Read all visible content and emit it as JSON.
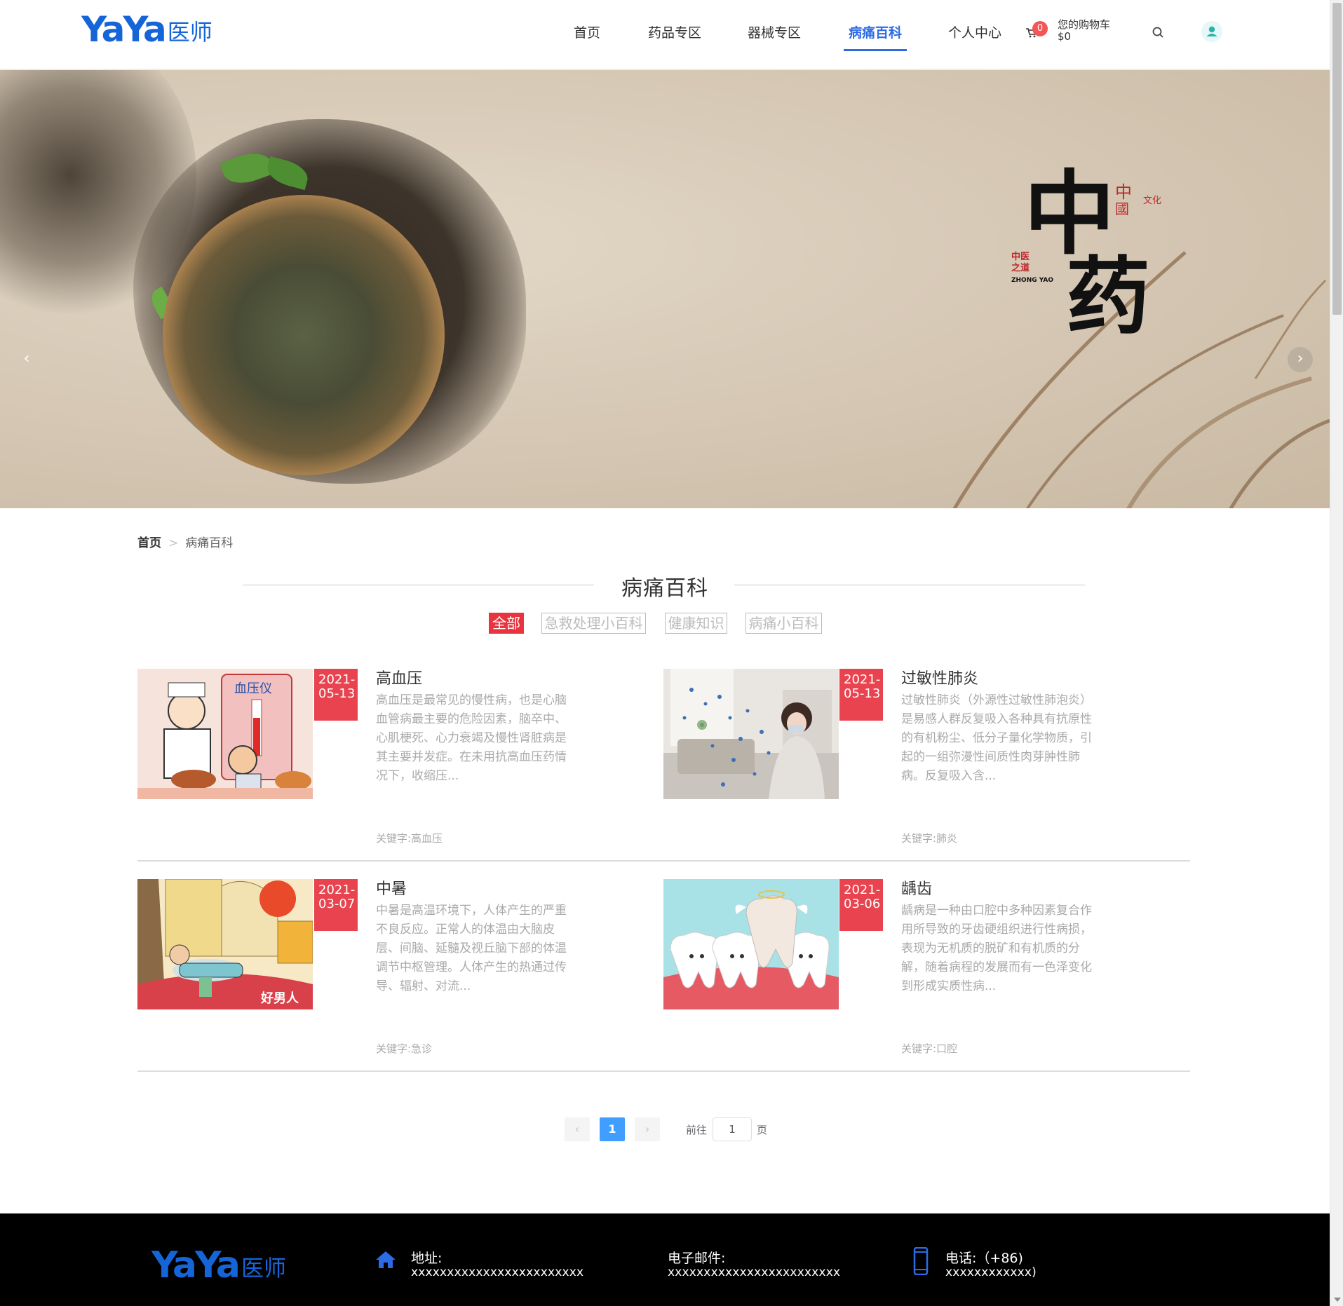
{
  "brand": {
    "logo_latin": "YaYa",
    "logo_cn": "医师",
    "accent": "#2d6be6",
    "logo_color": "#1565d8"
  },
  "nav": {
    "items": [
      {
        "label": "首页"
      },
      {
        "label": "药品专区"
      },
      {
        "label": "器械专区"
      },
      {
        "label": "病痛百科",
        "active": true
      },
      {
        "label": "个人中心"
      }
    ],
    "cart": {
      "count": "0",
      "label": "您的购物车",
      "amount": "$0"
    },
    "search_icon": "search-icon",
    "user_icon": "user-icon"
  },
  "banner": {
    "calligraphy_text": "中药",
    "calligraphy_subtitle": "中医之道",
    "calligraphy_romanization": "ZHONG YAO",
    "seal_text": "中國文化",
    "slides_total": 4,
    "active_slide": 3,
    "prev_label": "‹",
    "next_label": "›"
  },
  "breadcrumb": {
    "home": "首页",
    "separator": ">",
    "current": "病痛百科"
  },
  "section": {
    "title": "病痛百科"
  },
  "filters": [
    {
      "label": "全部",
      "active": true
    },
    {
      "label": "急救处理小百科"
    },
    {
      "label": "健康知识"
    },
    {
      "label": "病痛小百科"
    }
  ],
  "articles": [
    {
      "date_line1": "2021-",
      "date_line2": "05-13",
      "title": "高血压",
      "desc": "高血压是最常见的慢性病，也是心脑血管病最主要的危险因素，脑卒中、心肌梗死、心力衰竭及慢性肾脏病是其主要并发症。在未用抗高血压药情况下，收缩压...",
      "keyword": "关键字:高血压",
      "image_text": "血压仪"
    },
    {
      "date_line1": "2021-",
      "date_line2": "05-13",
      "title": "过敏性肺炎",
      "desc": "过敏性肺炎（外源性过敏性肺泡炎）是易感人群反复吸入各种具有抗原性的有机粉尘、低分子量化学物质，引起的一组弥漫性间质性肉芽肿性肺病。反复吸入含...",
      "keyword": "关键字:肺炎"
    },
    {
      "date_line1": "2021-",
      "date_line2": "03-07",
      "title": "中暑",
      "desc": "中暑是高温环境下，人体产生的严重不良反应。正常人的体温由大脑皮层、间脑、延髓及视丘脑下部的体温调节中枢管理。人体产生的热通过传导、辐射、对流...",
      "keyword": "关键字:急诊",
      "image_text": "好男人"
    },
    {
      "date_line1": "2021-",
      "date_line2": "03-06",
      "title": "龋齿",
      "desc": "龋病是一种由口腔中多种因素复合作用所导致的牙齿硬组织进行性病损，表现为无机质的脱矿和有机质的分解，随着病程的发展而有一色泽变化到形成实质性病...",
      "keyword": "关键字:口腔"
    }
  ],
  "pagination": {
    "prev": "‹",
    "next": "›",
    "current_page": "1",
    "goto_label": "前往",
    "page_input": "1",
    "page_suffix": "页"
  },
  "footer": {
    "logo_latin": "YaYa",
    "logo_cn": "医师",
    "address_label": "地址:",
    "address_value": "xxxxxxxxxxxxxxxxxxxxxxxx",
    "email_label": "电子邮件:",
    "email_value": "xxxxxxxxxxxxxxxxxxxxxxxx",
    "phone_label": "电话:（+86)",
    "phone_value": "xxxxxxxxxxxx)",
    "home_icon": "home-icon",
    "phone_icon": "phone-icon"
  }
}
